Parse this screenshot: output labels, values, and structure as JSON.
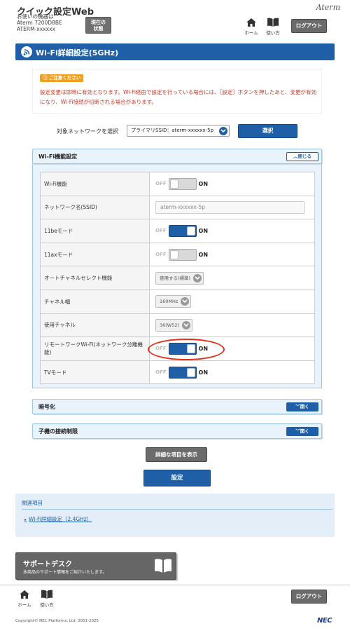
{
  "header": {
    "app_title": "クイック設定Web",
    "device_label": "お使いの機器は",
    "device_model": "Aterm 7200D8BE",
    "device_name": "ATERM-xxxxxx",
    "status_button_line1": "現在の",
    "status_button_line2": "状態",
    "brand": "Aterm",
    "home_label": "ホーム",
    "howto_label": "使い方",
    "logout_label": "ログアウト"
  },
  "page": {
    "title": "Wi-Fi詳細設定(5GHz)"
  },
  "caution": {
    "tag": "ご注意ください",
    "text": "設定変更は即時に有効となります。Wi-Fi経由で設定を行っている場合には、［設定］ボタンを押したあと、変更が有効になり、Wi-Fi接続が切断される場合があります。"
  },
  "target_network": {
    "label": "対象ネットワークを選択",
    "selected": "プライマリSSID：aterm-xxxxxx-5p",
    "select_button": "選択"
  },
  "wifi_function": {
    "title": "Wi-Fi機能設定",
    "close_label": "閉じる",
    "toggle_off": "OFF",
    "toggle_on": "ON",
    "rows": [
      {
        "label": "Wi-Fi機能",
        "type": "toggle",
        "state": "off"
      },
      {
        "label": "ネットワーク名(SSID)",
        "type": "input",
        "value": "aterm-xxxxxx-5p"
      },
      {
        "label": "11beモード",
        "type": "toggle",
        "state": "on"
      },
      {
        "label": "11axモード",
        "type": "toggle",
        "state": "off"
      },
      {
        "label": "オートチャネルセレクト機能",
        "type": "select",
        "value": "使用する(標準)"
      },
      {
        "label": "チャネル幅",
        "type": "select",
        "value": "160MHz"
      },
      {
        "label": "使用チャネル",
        "type": "select",
        "value": "36(W52)"
      },
      {
        "label": "リモートワークWi-Fi(ネットワーク分離機能)",
        "type": "toggle",
        "state": "on"
      },
      {
        "label": "TVモード",
        "type": "toggle",
        "state": "on"
      }
    ]
  },
  "sections": {
    "encryption_title": "暗号化",
    "restriction_title": "子機の接続制限",
    "open_label": "開く"
  },
  "buttons": {
    "show_detail": "詳細な項目を表示",
    "apply": "設定"
  },
  "related": {
    "title": "関連項目",
    "link": "Wi-Fi詳細設定（2.4GHz）"
  },
  "support": {
    "title": "サポートデスク",
    "subtitle": "本商品のサポート情報をご紹介いたします。"
  },
  "footer": {
    "copyright": "Copyright© NEC Platforms, Ltd. 2001-2025",
    "logo": "NEC"
  },
  "colors": {
    "accent": "#1f5fa8",
    "caution_text": "#c0392b",
    "highlight": "#e0301e"
  }
}
